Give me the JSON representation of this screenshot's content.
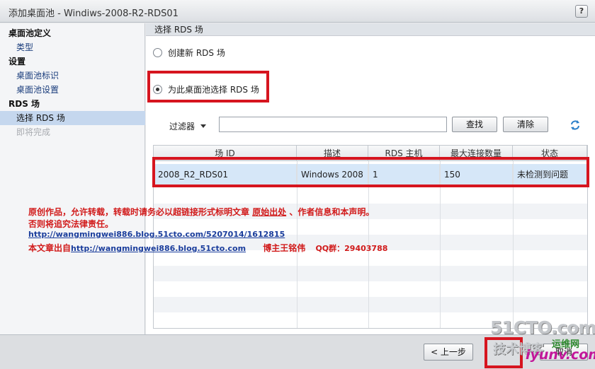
{
  "window": {
    "title": "添加桌面池 - Windiws-2008-R2-RDS01",
    "help_label": "?"
  },
  "sidebar": {
    "items": [
      {
        "label": "桌面池定义"
      },
      {
        "label": "类型"
      },
      {
        "label": "设置"
      },
      {
        "label": "桌面池标识"
      },
      {
        "label": "桌面池设置"
      },
      {
        "label": "RDS 场"
      },
      {
        "label": "选择 RDS 场"
      },
      {
        "label": "即将完成"
      }
    ]
  },
  "main": {
    "section_title": "选择 RDS 场",
    "option_create": "创建新 RDS 场",
    "option_select": "为此桌面池选择 RDS 场",
    "filter_label": "过滤器",
    "filter_value": "",
    "find_label": "查找",
    "clear_label": "清除",
    "refresh_icon": "refresh-icon"
  },
  "table": {
    "columns": [
      "场 ID",
      "描述",
      "RDS 主机",
      "最大连接数量",
      "状态"
    ],
    "rows": [
      [
        "2008_R2_RDS01",
        "Windows  2008",
        "1",
        "150",
        "未检测到问题"
      ]
    ]
  },
  "notice": {
    "line1_prefix": "原创作品，允许转载，转载时请务必以超链接形式标明文章",
    "line1_link": "原始出处",
    "line1_suffix": "、作者信息和本声明。",
    "line2": "否则将追究法律责任。",
    "url1": "http://wangmingwei886.blog.51cto.com/5207014/1612815",
    "line4_prefix": "本文章出自",
    "url2": "http://wangmingwei886.blog.51cto.com",
    "author": "博主王铭伟",
    "qq": "QQ群：29403788"
  },
  "footer": {
    "back_label": "< 上一步",
    "cancel_label": "取消"
  },
  "watermark": {
    "line1": "51CTO.com",
    "line2": "技术博客",
    "line3": "运维网",
    "line4": "iyunv.com"
  },
  "colors": {
    "highlight_red": "#d6151f",
    "selection": "#c5d7ee",
    "link_blue": "#1a3d9c",
    "notice_red": "#d11a1a"
  }
}
